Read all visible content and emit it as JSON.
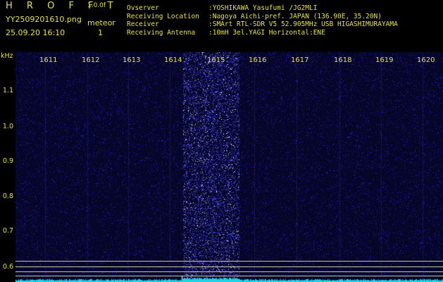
{
  "header": {
    "brand": "H R O F F T",
    "version": "1.0.0f",
    "filename": "YY2509201610.png",
    "datetime": "25.09.20 16:10",
    "event_label": "meteor",
    "event_count": "1",
    "info_labels": "Ovserver\nReceiving Location\nReceiver\nReceiving Antenna",
    "info_values": ":YOSHIKAWA Yasufumi /JG2MLI\n:Nagoya Aichi-pref. JAPAN (136.90E, 35.20N)\n:SMArt RTL-SDR V5 52.905MHz USB HIGASHIMURAYAMA\n:10mH 3el.YAGI Horizontal:ENE"
  },
  "axes": {
    "y_unit": "kHz",
    "y_ticks": [
      "1.1",
      "1.0",
      "0.9",
      "0.8",
      "0.7",
      "0.6"
    ],
    "x_ticks": [
      "1611",
      "1612",
      "1613",
      "1614",
      "1615",
      "1616",
      "1617",
      "1618",
      "1619",
      "1620"
    ]
  },
  "colors": {
    "text": "#e8e23a",
    "background": "#06062a",
    "noise": "#2a2ae0",
    "trace": "#19d6e6",
    "guide": "#c9c7a0"
  }
}
